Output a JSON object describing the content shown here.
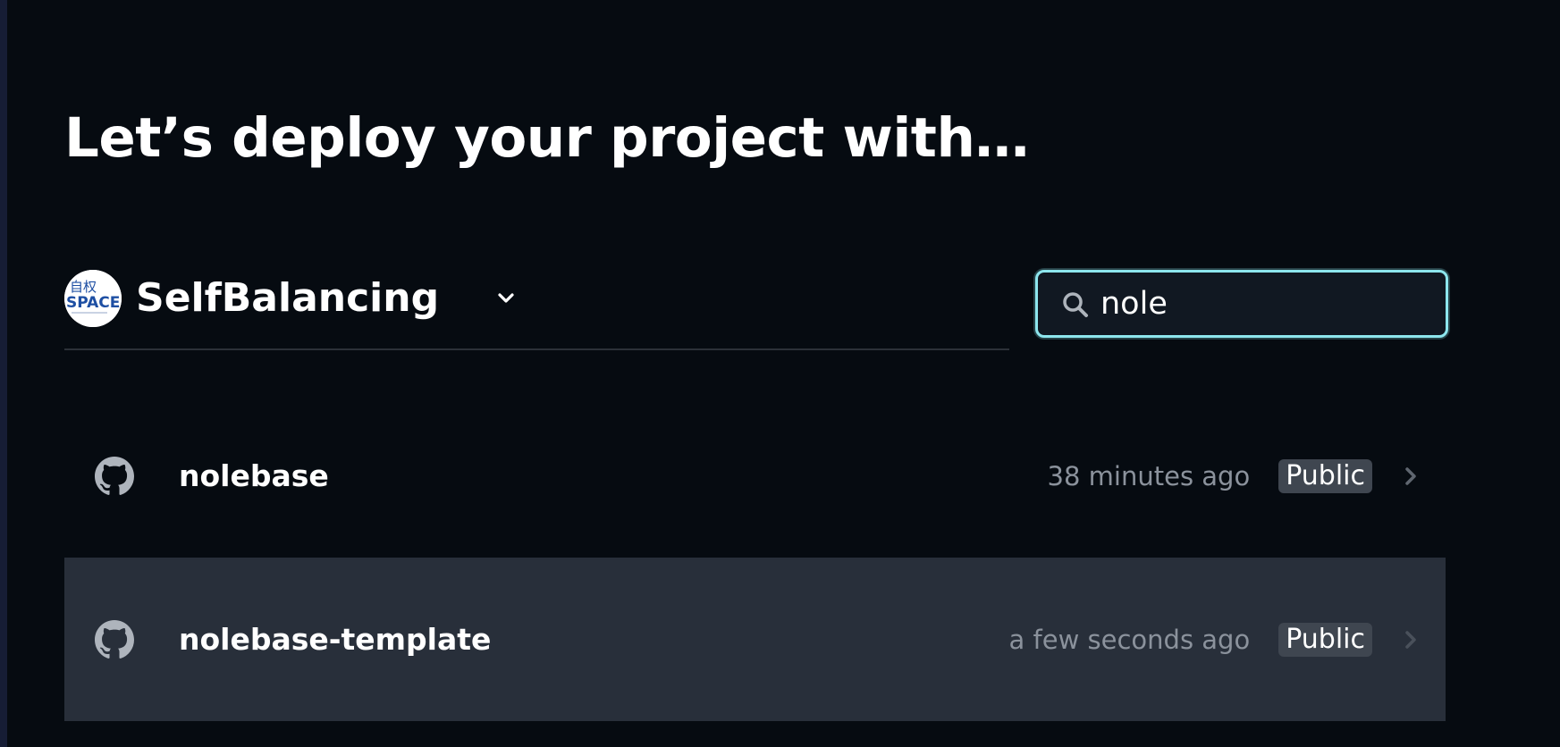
{
  "page": {
    "title": "Let’s deploy your project with…"
  },
  "account": {
    "name": "SelfBalancing",
    "avatar_text_top": "自权",
    "avatar_text_main": "SPACE"
  },
  "search": {
    "value": "nole",
    "placeholder": "",
    "focus_color": "#8de6ee"
  },
  "repos": [
    {
      "name": "nolebase",
      "updated": "38 minutes ago",
      "visibility": "Public",
      "icon": "github-icon"
    },
    {
      "name": "nolebase-template",
      "updated": "a few seconds ago",
      "visibility": "Public",
      "icon": "github-icon"
    }
  ],
  "colors": {
    "background": "#060b11",
    "row_highlight": "#282f3a",
    "badge": "#3f4650",
    "muted_text": "#8b929c"
  }
}
